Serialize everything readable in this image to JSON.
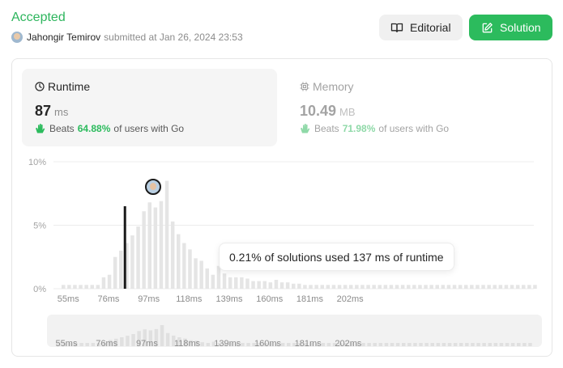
{
  "header": {
    "status": "Accepted",
    "submitter_name": "Jahongir Temirov",
    "submitted_text": "submitted at Jan 26, 2024 23:53",
    "editorial_label": "Editorial",
    "solution_label": "Solution"
  },
  "runtime": {
    "label": "Runtime",
    "value": "87",
    "unit": "ms",
    "beats_prefix": "Beats",
    "beats_pct": "64.88%",
    "beats_suffix": "of users with Go"
  },
  "memory": {
    "label": "Memory",
    "value": "10.49",
    "unit": "MB",
    "beats_prefix": "Beats",
    "beats_pct": "71.98%",
    "beats_suffix": "of users with Go"
  },
  "tooltip": "0.21% of solutions used 137 ms of runtime",
  "colors": {
    "accepted": "#2db55d",
    "solution_button": "#2cbb5d",
    "bar": "#e5e5e5",
    "selected_bar": "#1a1a1a",
    "grid": "#ececec"
  },
  "icons": {
    "editorial": "book-open-icon",
    "solution": "pencil-square-icon",
    "runtime": "clock-icon",
    "memory": "chip-icon",
    "beats": "clapping-hands-icon"
  },
  "chart_data": {
    "type": "bar",
    "y_ticks": [
      "0%",
      "5%",
      "10%"
    ],
    "ylim": [
      0,
      10
    ],
    "x_ticks": [
      "55ms",
      "76ms",
      "97ms",
      "118ms",
      "139ms",
      "160ms",
      "181ms",
      "202ms"
    ],
    "bins": [
      "55",
      "58",
      "61",
      "64",
      "67",
      "70",
      "73",
      "76",
      "79",
      "82",
      "85",
      "88",
      "91",
      "94",
      "97",
      "100",
      "103",
      "106",
      "109",
      "112",
      "115",
      "118",
      "121",
      "124",
      "127",
      "130",
      "133",
      "136",
      "139",
      "142",
      "145",
      "148",
      "151",
      "154",
      "157",
      "160",
      "163",
      "166",
      "169",
      "172",
      "175",
      "178",
      "181",
      "184",
      "187",
      "190",
      "193",
      "196",
      "199",
      "202",
      "205",
      "208",
      "211",
      "214",
      "217",
      "220",
      "223",
      "226",
      "229",
      "232",
      "235",
      "238",
      "241",
      "244",
      "247",
      "250",
      "253",
      "256",
      "259",
      "262",
      "265",
      "268",
      "271",
      "274",
      "277",
      "280",
      "283",
      "286",
      "289",
      "292",
      "295",
      "298",
      "301"
    ],
    "values": [
      0.3,
      0.3,
      0.3,
      0.3,
      0.3,
      0.3,
      0.3,
      0.9,
      1.1,
      2.5,
      3.0,
      3.6,
      4.2,
      4.9,
      6.1,
      6.8,
      6.4,
      6.9,
      8.5,
      5.3,
      4.3,
      3.6,
      3.1,
      2.4,
      2.2,
      1.6,
      1.1,
      1.8,
      1.2,
      0.9,
      0.9,
      0.9,
      0.8,
      0.6,
      0.6,
      0.6,
      0.5,
      0.7,
      0.5,
      0.5,
      0.4,
      0.4,
      0.3,
      0.3,
      0.3,
      0.3,
      0.3,
      0.3,
      0.3,
      0.3,
      0.3,
      0.3,
      0.3,
      0.3,
      0.3,
      0.3,
      0.3,
      0.3,
      0.3,
      0.3,
      0.3,
      0.3,
      0.3,
      0.3,
      0.3,
      0.3,
      0.3,
      0.3,
      0.3,
      0.3,
      0.3,
      0.3,
      0.3,
      0.3,
      0.3,
      0.3,
      0.3,
      0.3,
      0.3,
      0.3,
      0.3,
      0.3,
      0.3
    ],
    "selected_bin": "87",
    "selected_value": 6.5,
    "tooltip_bin": "137",
    "tooltip_value": 0.21,
    "grid": true
  }
}
